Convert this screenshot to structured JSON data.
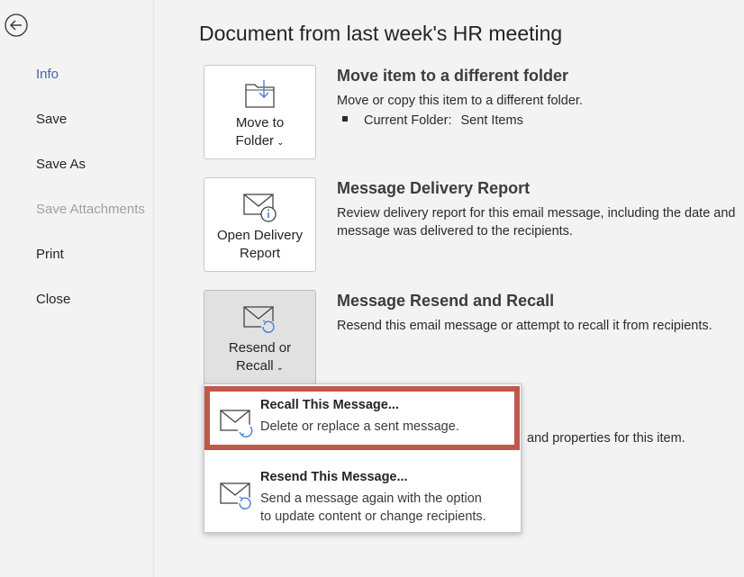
{
  "sidebar": {
    "items": [
      {
        "label": "Info",
        "state": "active"
      },
      {
        "label": "Save",
        "state": "normal"
      },
      {
        "label": "Save As",
        "state": "normal"
      },
      {
        "label": "Save Attachments",
        "state": "disabled"
      },
      {
        "label": "Print",
        "state": "normal"
      },
      {
        "label": "Close",
        "state": "normal"
      }
    ]
  },
  "main": {
    "title": "Document from last week's HR meeting",
    "move": {
      "button_line1": "Move to",
      "button_line2": "Folder",
      "heading": "Move item to a different folder",
      "desc": "Move or copy this item to a different folder.",
      "folder_label": "Current Folder:",
      "folder_value": "Sent Items"
    },
    "delivery": {
      "button_line1": "Open Delivery",
      "button_line2": "Report",
      "heading": "Message Delivery Report",
      "desc_line1": "Review delivery report for this email message, including the date and",
      "desc_line2": "message was delivered to the recipients."
    },
    "resend": {
      "button_line1": "Resend or",
      "button_line2": "Recall",
      "heading": "Message Resend and Recall",
      "desc": "Resend this email message or attempt to recall it from recipients."
    },
    "behind_text": "and properties for this item."
  },
  "dropdown": {
    "recall": {
      "title": "Recall This Message...",
      "desc": "Delete or replace a sent message."
    },
    "resend": {
      "title": "Resend This Message...",
      "desc_line1": "Send a message again with the option",
      "desc_line2": "to update content or change recipients."
    }
  },
  "colors": {
    "accent": "#4a63a7",
    "highlight": "#c0574a",
    "icon_blue": "#4a7fd4"
  }
}
